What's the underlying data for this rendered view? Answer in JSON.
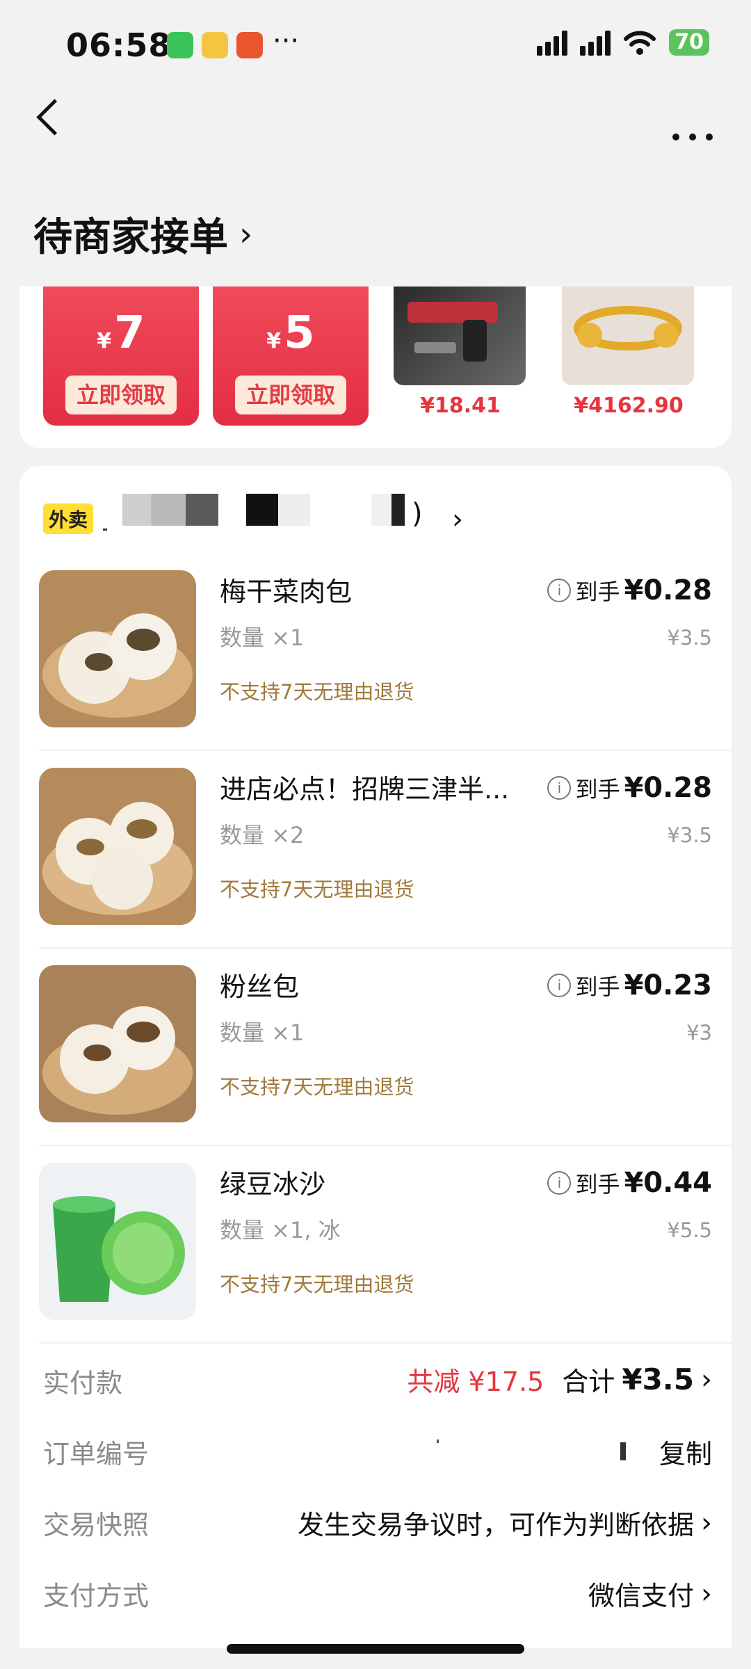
{
  "status": {
    "time": "06:58",
    "more": "···",
    "battery": "70"
  },
  "header": {
    "title": "待商家接单",
    "title_chevron": "›"
  },
  "coupons": [
    {
      "currency": "¥",
      "amount": "7",
      "button": "立即领取"
    },
    {
      "currency": "¥",
      "amount": "5",
      "button": "立即领取"
    }
  ],
  "recommend": [
    {
      "price": "¥18.41",
      "image_icon": "toy-gun-image"
    },
    {
      "price": "¥4162.90",
      "image_icon": "gold-bangle-image"
    }
  ],
  "store": {
    "tag": "外卖",
    "suffix": ")",
    "chevron": "›"
  },
  "items": [
    {
      "name": "梅干菜肉包",
      "qty": "数量 ×1",
      "note": "不支持7天无理由退货",
      "price_label": "到手",
      "price": "¥0.28",
      "orig": "¥3.5"
    },
    {
      "name": "进店必点！招牌三津半...",
      "qty": "数量 ×2",
      "note": "不支持7天无理由退货",
      "price_label": "到手",
      "price": "¥0.28",
      "orig": "¥3.5"
    },
    {
      "name": "粉丝包",
      "qty": "数量 ×1",
      "note": "不支持7天无理由退货",
      "price_label": "到手",
      "price": "¥0.23",
      "orig": "¥3"
    },
    {
      "name": "绿豆冰沙",
      "qty": "数量 ×1, 冰",
      "note": "不支持7天无理由退货",
      "price_label": "到手",
      "price": "¥0.44",
      "orig": "¥5.5"
    }
  ],
  "summary": {
    "paid_label": "实付款",
    "discount": "共减 ¥17.5",
    "total_label": "合计",
    "total": "¥3.5",
    "order_label": "订单编号",
    "copy": "复制",
    "snapshot_label": "交易快照",
    "snapshot_value": "发生交易争议时，可作为判断依据",
    "pay_label": "支付方式",
    "pay_value": "微信支付",
    "chevron": "›"
  },
  "colors": {
    "accent_red": "#e6353d",
    "note_brown": "#a07a3c",
    "coupon_red": "#e42d44"
  }
}
